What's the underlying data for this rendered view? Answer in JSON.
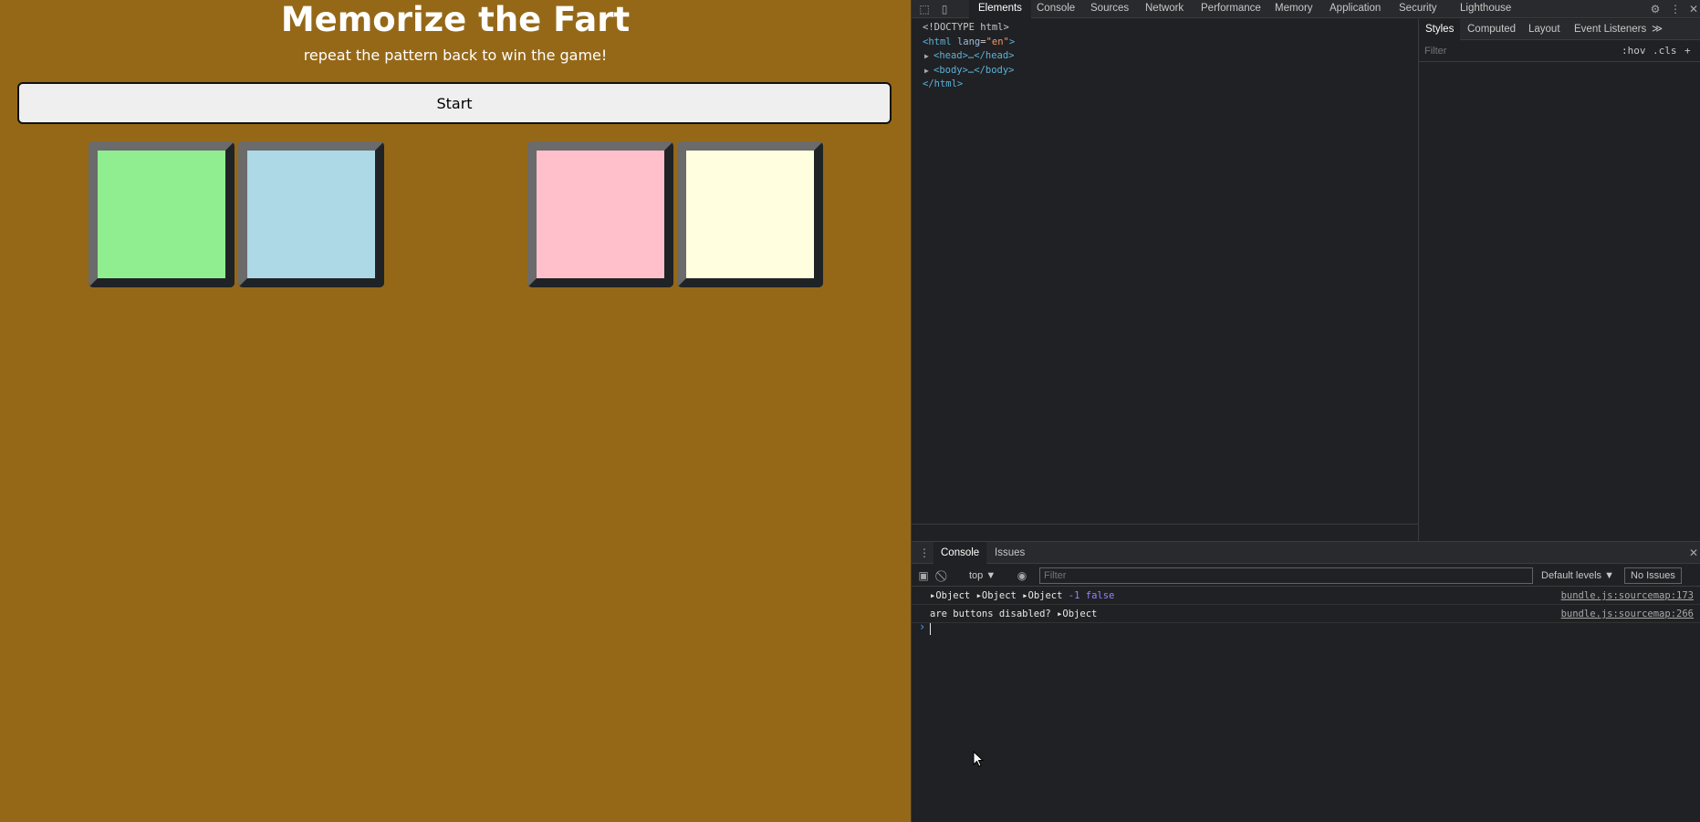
{
  "game": {
    "title": "Memorize the Fart",
    "subtitle": "repeat the pattern back to win the game!",
    "start_label": "Start",
    "pads": [
      {
        "name": "green",
        "color": "#90ee90"
      },
      {
        "name": "blue",
        "color": "#add8e6"
      },
      {
        "name": "pink",
        "color": "#ffc0cb"
      },
      {
        "name": "yellow",
        "color": "#ffffe0"
      }
    ]
  },
  "devtools": {
    "tabs": [
      "Elements",
      "Console",
      "Sources",
      "Network",
      "Performance",
      "Memory",
      "Application",
      "Security",
      "Lighthouse"
    ],
    "active_tab": "Elements",
    "elements": {
      "doctype": "<!DOCTYPE html>",
      "html_open": "<html",
      "lang_attr": "lang",
      "lang_val": "\"en\"",
      "html_open_end": ">",
      "head": "<head>…</head>",
      "body": "<body>…</body>",
      "html_close": "</html>"
    },
    "styles": {
      "tabs": [
        "Styles",
        "Computed",
        "Layout",
        "Event Listeners"
      ],
      "more": "≫",
      "filter_placeholder": "Filter",
      "hov": ":hov",
      "cls": ".cls",
      "add": "+"
    },
    "drawer": {
      "tabs": [
        "Console",
        "Issues"
      ],
      "context": "top ▼",
      "filter_placeholder": "Filter",
      "levels": "Default levels ▼",
      "issues": "No Issues",
      "logs": [
        {
          "parts": [
            "▸Object",
            "▸Object",
            "▸Object"
          ],
          "num": "-1",
          "bool": "false",
          "source": "bundle.js:sourcemap:173"
        },
        {
          "text": "are buttons disabled?",
          "obj": "▸Object",
          "source": "bundle.js:sourcemap:266"
        }
      ],
      "prompt": "›"
    }
  }
}
